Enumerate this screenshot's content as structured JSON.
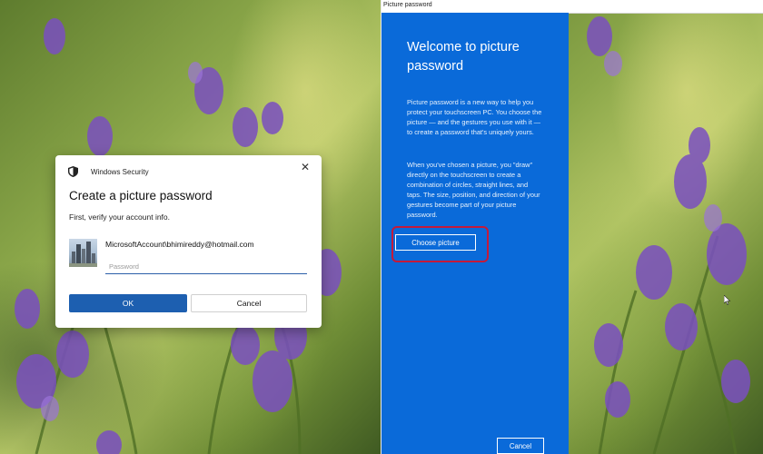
{
  "left": {
    "dialog": {
      "app_name": "Windows Security",
      "close_glyph": "✕",
      "title": "Create a picture password",
      "subtitle": "First, verify your account info.",
      "account": "MicrosoftAccount\\bhimireddy@hotmail.com",
      "password_value": "",
      "password_placeholder": "Password",
      "ok_label": "OK",
      "cancel_label": "Cancel",
      "accent_color": "#1d5fb0"
    }
  },
  "right": {
    "window_title": "Picture password",
    "heading": "Welcome to picture password",
    "paragraph1": "Picture password is a new way to help you protect your touchscreen PC. You choose the picture — and the gestures you use with it — to create a password that's uniquely yours.",
    "paragraph2": "When you've chosen a picture, you \"draw\" directly on the touchscreen to create a combination of circles, straight lines, and taps. The size, position, and direction of your gestures become part of your picture password.",
    "choose_label": "Choose picture",
    "cancel_label": "Cancel",
    "pane_color": "#0a6ad9",
    "highlight_color": "#c41a3a"
  },
  "icons": {
    "shield": "shield-icon",
    "close": "close-icon",
    "avatar": "avatar-city-photo",
    "cursor": "mouse-cursor-icon"
  }
}
